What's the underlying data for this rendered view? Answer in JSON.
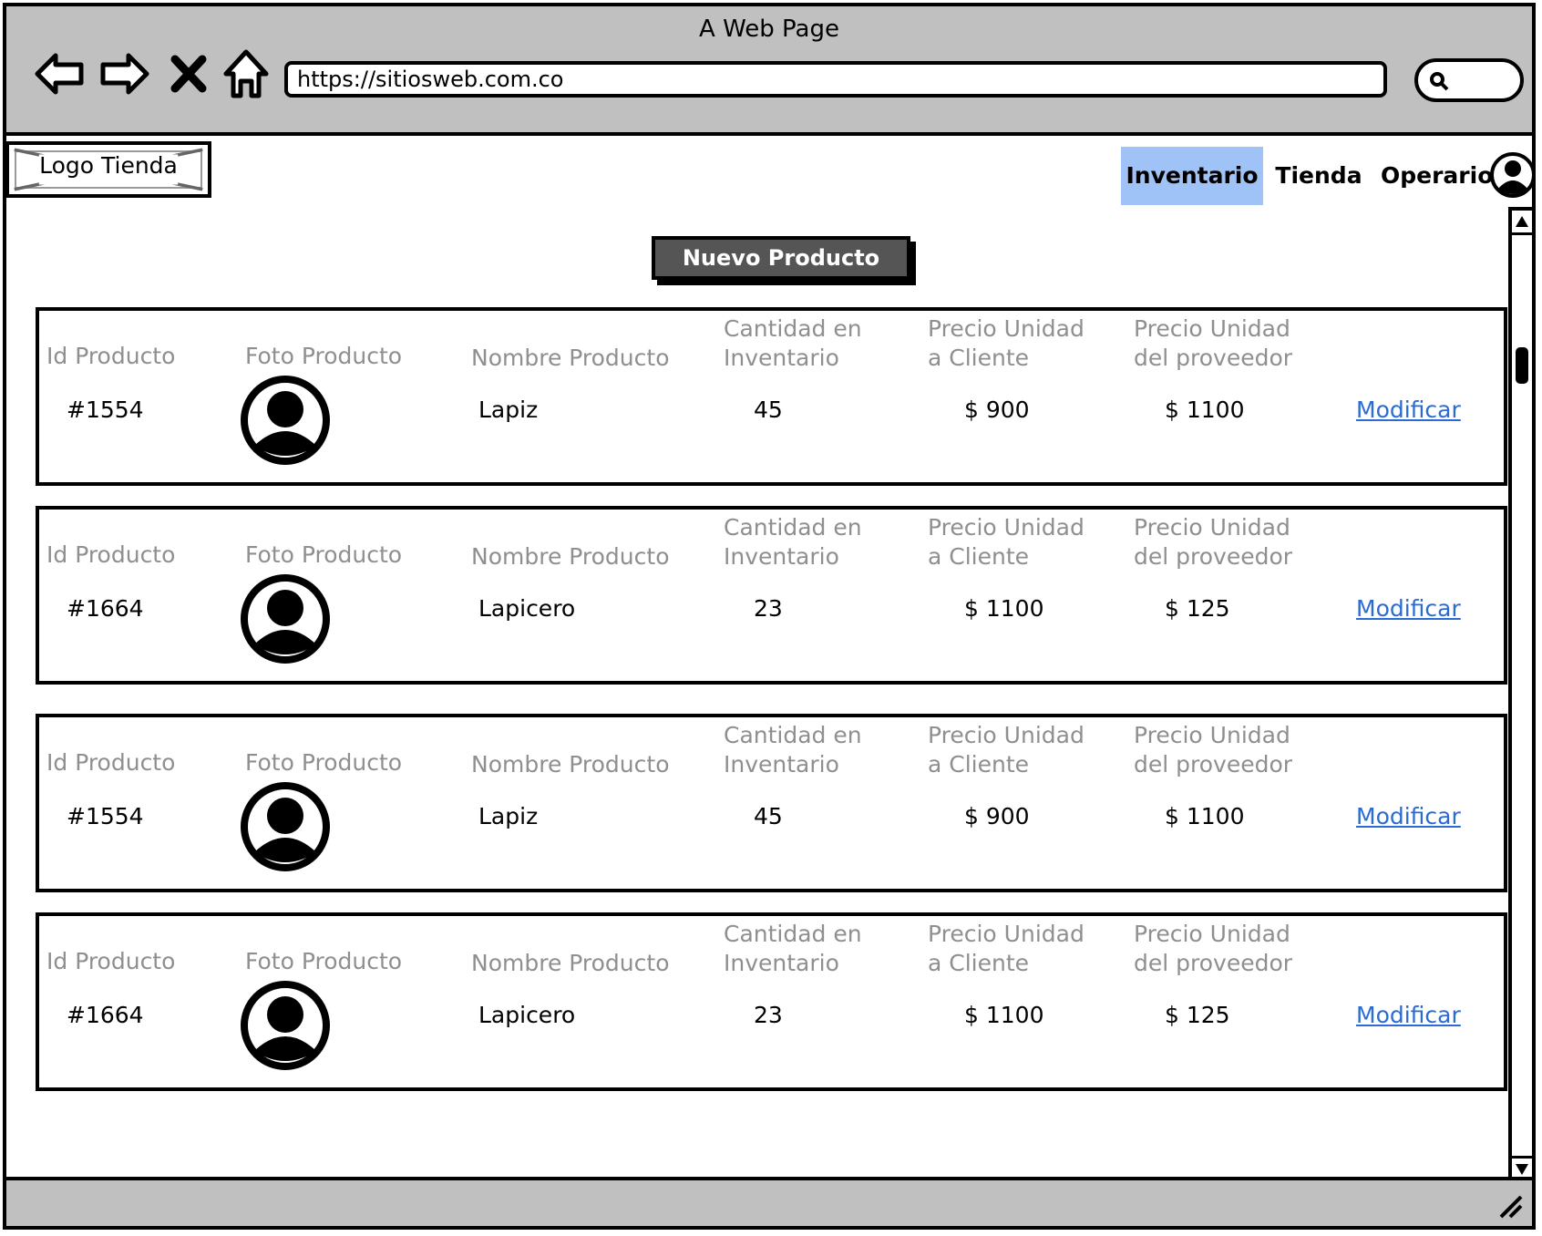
{
  "window": {
    "title": "A Web Page",
    "url": "https://sitiosweb.com.co"
  },
  "header": {
    "logo_label": "Logo Tienda",
    "nav": [
      {
        "label": "Inventario",
        "active": true
      },
      {
        "label": "Tienda",
        "active": false
      },
      {
        "label": "Operario",
        "active": false
      }
    ]
  },
  "actions": {
    "new_product_label": "Nuevo Producto"
  },
  "columns": {
    "id": "Id Producto",
    "photo": "Foto Producto",
    "name": "Nombre Producto",
    "qty_line1": "Cantidad en",
    "qty_line2": "Inventario",
    "client_line1": "Precio Unidad",
    "client_line2": "a Cliente",
    "supplier_line1": "Precio Unidad",
    "supplier_line2": "del proveedor"
  },
  "products": [
    {
      "id": "#1554",
      "name": "Lapiz",
      "qty": "45",
      "client_price": "$ 900",
      "supplier_price": "$ 1100",
      "action": "Modificar"
    },
    {
      "id": "#1664",
      "name": "Lapicero",
      "qty": "23",
      "client_price": "$ 1100",
      "supplier_price": "$ 125",
      "action": "Modificar"
    },
    {
      "id": "#1554",
      "name": "Lapiz",
      "qty": "45",
      "client_price": "$ 900",
      "supplier_price": "$ 1100",
      "action": "Modificar"
    },
    {
      "id": "#1664",
      "name": "Lapicero",
      "qty": "23",
      "client_price": "$ 1100",
      "supplier_price": "$ 125",
      "action": "Modificar"
    }
  ],
  "colors": {
    "nav_active": "#9fc3f7",
    "link": "#2a6bd6",
    "header_text": "#8f8f8f",
    "chrome": "#c0c0c0",
    "button": "#555555"
  }
}
